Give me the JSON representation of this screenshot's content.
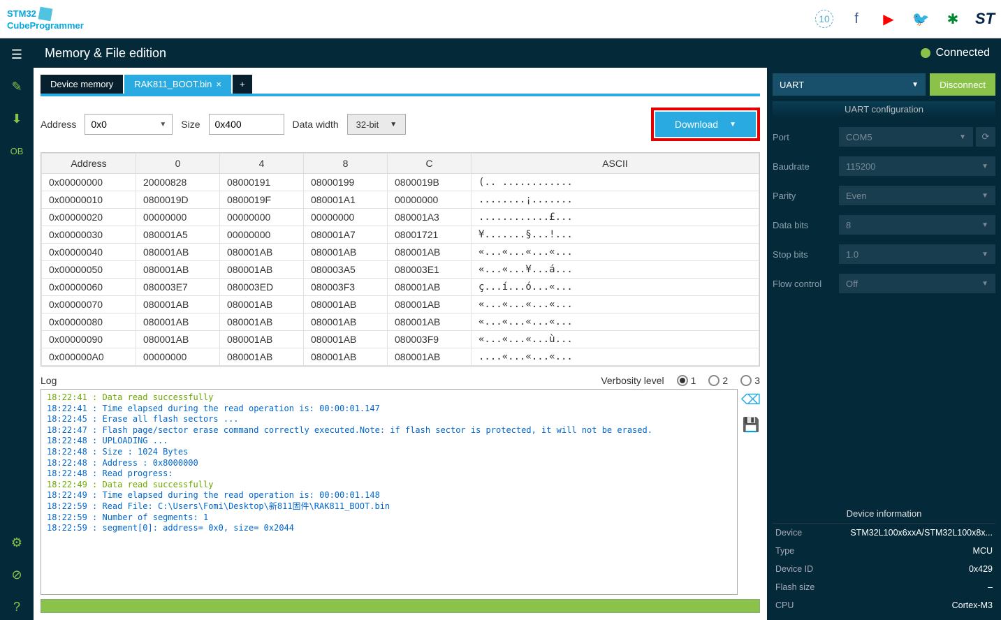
{
  "app": {
    "name_line1": "STM32",
    "name_line2": "CubeProgrammer"
  },
  "header": {
    "title": "Memory & File edition",
    "status": "Connected"
  },
  "tabs": {
    "t0": "Device memory",
    "t1": "RAK811_BOOT.bin",
    "add": "+"
  },
  "toolbar": {
    "address_label": "Address",
    "address_value": "0x0",
    "size_label": "Size",
    "size_value": "0x400",
    "datawidth_label": "Data width",
    "datawidth_value": "32-bit",
    "download_label": "Download"
  },
  "table": {
    "headers": {
      "addr": "Address",
      "c0": "0",
      "c4": "4",
      "c8": "8",
      "cc": "C",
      "ascii": "ASCII"
    },
    "rows": [
      {
        "addr": "0x00000000",
        "c0": "20000828",
        "c4": "08000191",
        "c8": "08000199",
        "cc": "0800019B",
        "ascii": "(.. ............"
      },
      {
        "addr": "0x00000010",
        "c0": "0800019D",
        "c4": "0800019F",
        "c8": "080001A1",
        "cc": "00000000",
        "ascii": "........¡......."
      },
      {
        "addr": "0x00000020",
        "c0": "00000000",
        "c4": "00000000",
        "c8": "00000000",
        "cc": "080001A3",
        "ascii": "............£..."
      },
      {
        "addr": "0x00000030",
        "c0": "080001A5",
        "c4": "00000000",
        "c8": "080001A7",
        "cc": "08001721",
        "ascii": "¥.......§...!..."
      },
      {
        "addr": "0x00000040",
        "c0": "080001AB",
        "c4": "080001AB",
        "c8": "080001AB",
        "cc": "080001AB",
        "ascii": "«...«...«...«..."
      },
      {
        "addr": "0x00000050",
        "c0": "080001AB",
        "c4": "080001AB",
        "c8": "080003A5",
        "cc": "080003E1",
        "ascii": "«...«...¥...á..."
      },
      {
        "addr": "0x00000060",
        "c0": "080003E7",
        "c4": "080003ED",
        "c8": "080003F3",
        "cc": "080001AB",
        "ascii": "ç...í...ó...«..."
      },
      {
        "addr": "0x00000070",
        "c0": "080001AB",
        "c4": "080001AB",
        "c8": "080001AB",
        "cc": "080001AB",
        "ascii": "«...«...«...«..."
      },
      {
        "addr": "0x00000080",
        "c0": "080001AB",
        "c4": "080001AB",
        "c8": "080001AB",
        "cc": "080001AB",
        "ascii": "«...«...«...«..."
      },
      {
        "addr": "0x00000090",
        "c0": "080001AB",
        "c4": "080001AB",
        "c8": "080001AB",
        "cc": "080003F9",
        "ascii": "«...«...«...ù..."
      },
      {
        "addr": "0x000000A0",
        "c0": "00000000",
        "c4": "080001AB",
        "c8": "080001AB",
        "cc": "080001AB",
        "ascii": "....«...«...«..."
      }
    ]
  },
  "log": {
    "title": "Log",
    "verbosity_label": "Verbosity level",
    "v1": "1",
    "v2": "2",
    "v3": "3",
    "lines": [
      {
        "t": "18:22:41 : Data read successfully",
        "cls": "green"
      },
      {
        "t": "18:22:41 : Time elapsed during the read operation is: 00:00:01.147",
        "cls": ""
      },
      {
        "t": "18:22:45 : Erase all flash sectors ...",
        "cls": ""
      },
      {
        "t": "18:22:47 : Flash page/sector erase command correctly executed.Note: if flash sector is protected, it will not be erased.",
        "cls": ""
      },
      {
        "t": "18:22:48 : UPLOADING ...",
        "cls": ""
      },
      {
        "t": "18:22:48 : Size : 1024 Bytes",
        "cls": ""
      },
      {
        "t": "18:22:48 : Address : 0x8000000",
        "cls": ""
      },
      {
        "t": "18:22:48 : Read progress:",
        "cls": ""
      },
      {
        "t": "18:22:49 : Data read successfully",
        "cls": "green"
      },
      {
        "t": "18:22:49 : Time elapsed during the read operation is: 00:00:01.148",
        "cls": ""
      },
      {
        "t": "18:22:59 : Read File: C:\\Users\\Fomi\\Desktop\\新811固件\\RAK811_BOOT.bin",
        "cls": ""
      },
      {
        "t": "18:22:59 : Number of segments: 1",
        "cls": ""
      },
      {
        "t": "18:22:59 : segment[0]: address= 0x0, size= 0x2044",
        "cls": ""
      }
    ]
  },
  "rightpanel": {
    "conn_type": "UART",
    "disconnect": "Disconnect",
    "config_title": "UART configuration",
    "fields": {
      "port_label": "Port",
      "port_value": "COM5",
      "baud_label": "Baudrate",
      "baud_value": "115200",
      "parity_label": "Parity",
      "parity_value": "Even",
      "databits_label": "Data bits",
      "databits_value": "8",
      "stopbits_label": "Stop bits",
      "stopbits_value": "1.0",
      "flow_label": "Flow control",
      "flow_value": "Off"
    },
    "devinfo_title": "Device information",
    "devinfo": {
      "device_k": "Device",
      "device_v": "STM32L100x6xxA/STM32L100x8x...",
      "type_k": "Type",
      "type_v": "MCU",
      "id_k": "Device ID",
      "id_v": "0x429",
      "flash_k": "Flash size",
      "flash_v": "–",
      "cpu_k": "CPU",
      "cpu_v": "Cortex-M3"
    }
  }
}
